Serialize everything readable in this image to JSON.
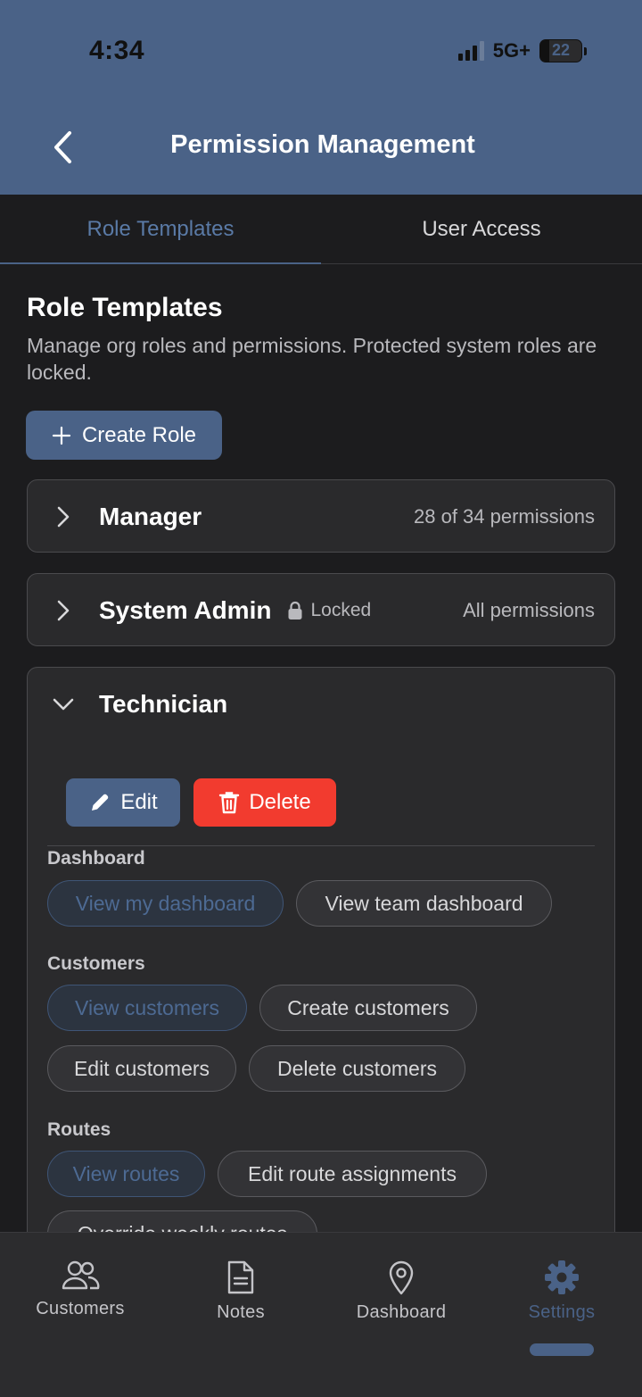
{
  "status": {
    "time": "4:34",
    "network": "5G+",
    "battery": "22"
  },
  "header": {
    "title": "Permission Management"
  },
  "tabs": [
    {
      "label": "Role Templates",
      "active": true
    },
    {
      "label": "User Access",
      "active": false
    }
  ],
  "section": {
    "title": "Role Templates",
    "description": "Manage org roles and permissions. Protected system roles are locked.",
    "create_label": "Create Role"
  },
  "roles": [
    {
      "name": "Manager",
      "meta": "28 of 34 permissions",
      "expanded": false
    },
    {
      "name": "System Admin",
      "lock_label": "Locked",
      "meta": "All permissions",
      "expanded": false
    },
    {
      "name": "Technician",
      "expanded": true,
      "edit_label": "Edit",
      "delete_label": "Delete",
      "groups": [
        {
          "label": "Dashboard",
          "chips": [
            {
              "label": "View my dashboard",
              "granted": true
            },
            {
              "label": "View team dashboard",
              "granted": false
            }
          ]
        },
        {
          "label": "Customers",
          "chips": [
            {
              "label": "View customers",
              "granted": true
            },
            {
              "label": "Create customers",
              "granted": false
            },
            {
              "label": "Edit customers",
              "granted": false
            },
            {
              "label": "Delete customers",
              "granted": false
            }
          ]
        },
        {
          "label": "Routes",
          "chips": [
            {
              "label": "View routes",
              "granted": true
            },
            {
              "label": "Edit route assignments",
              "granted": false
            },
            {
              "label": "Override weekly routes",
              "granted": false
            }
          ]
        }
      ]
    }
  ],
  "bottom_nav": [
    {
      "label": "Customers",
      "icon": "users-icon",
      "active": false
    },
    {
      "label": "Notes",
      "icon": "document-icon",
      "active": false
    },
    {
      "label": "Dashboard",
      "icon": "map-pin-icon",
      "active": false
    },
    {
      "label": "Settings",
      "icon": "gear-icon",
      "active": true
    }
  ],
  "colors": {
    "accent": "#4a6287",
    "danger": "#f23b2f",
    "background": "#1c1c1e",
    "card": "#2a2a2c"
  }
}
